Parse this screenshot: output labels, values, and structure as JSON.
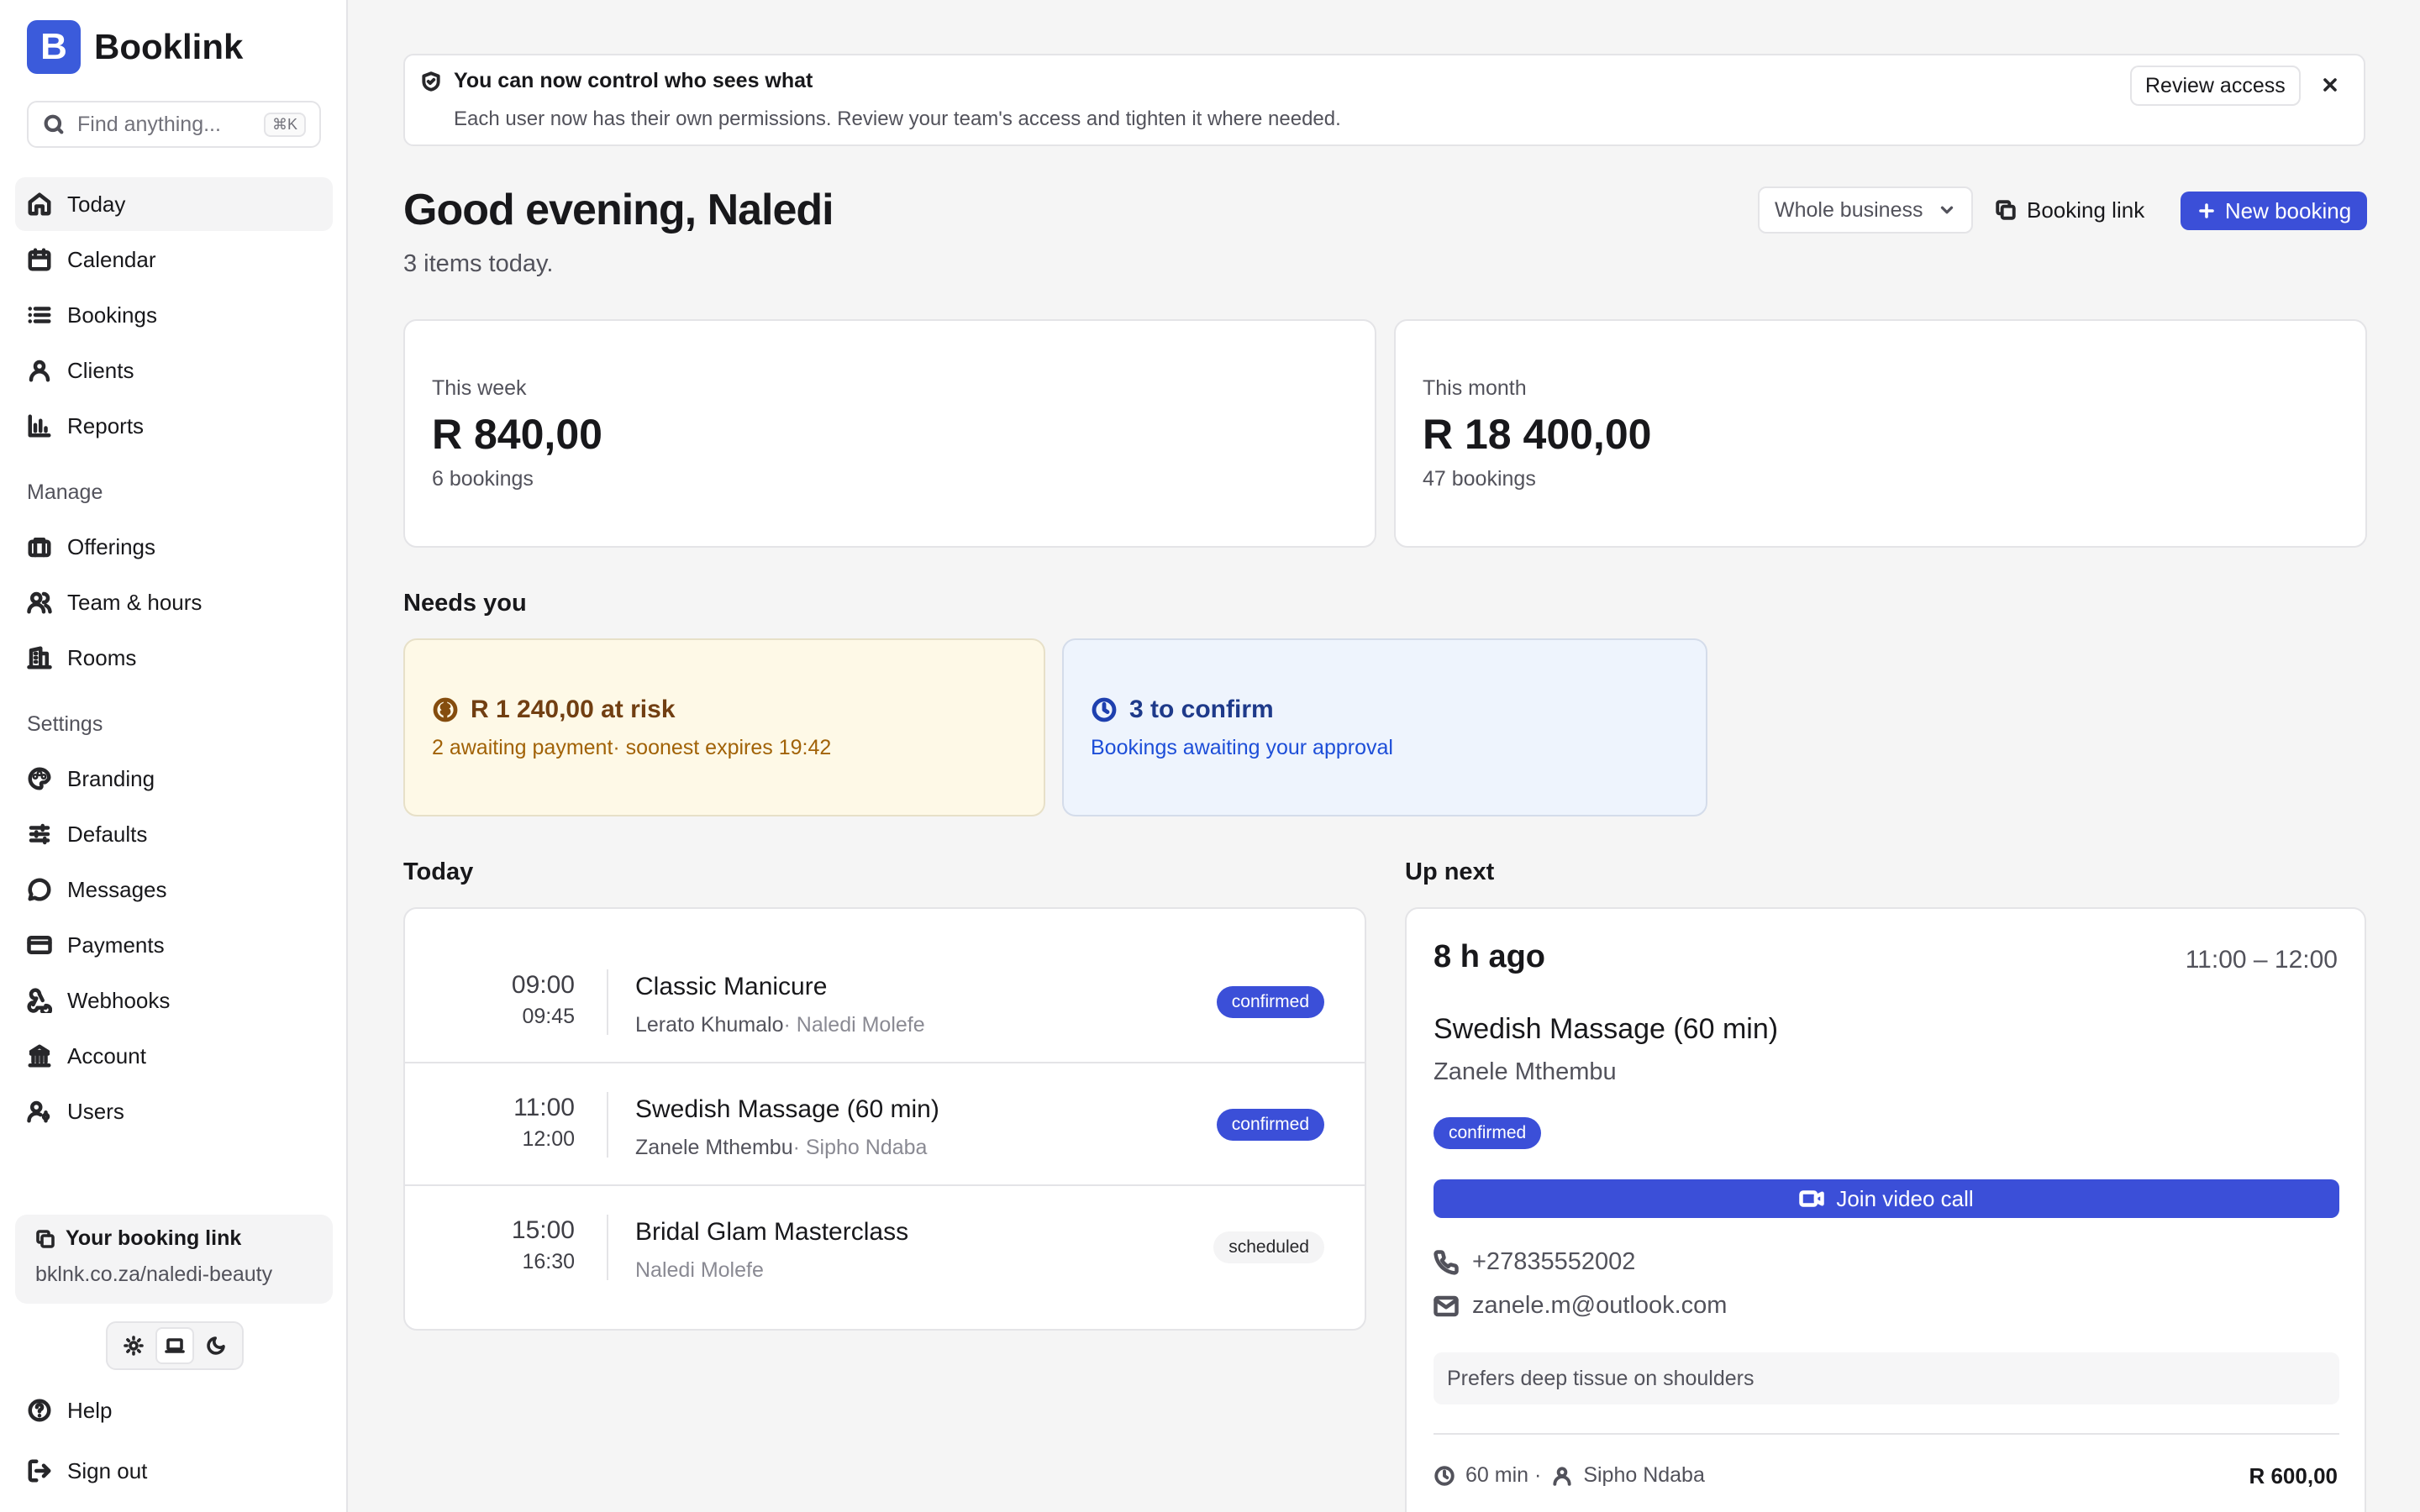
{
  "app": {
    "name": "Booklink",
    "logo_letter": "B"
  },
  "search": {
    "placeholder": "Find anything...",
    "shortcut": "⌘K"
  },
  "nav": {
    "main": [
      {
        "label": "Today",
        "icon": "home-icon",
        "active": true
      },
      {
        "label": "Calendar",
        "icon": "calendar-icon"
      },
      {
        "label": "Bookings",
        "icon": "list-icon"
      },
      {
        "label": "Clients",
        "icon": "users-icon"
      },
      {
        "label": "Reports",
        "icon": "bar-chart-icon"
      }
    ],
    "manage_label": "Manage",
    "manage": [
      {
        "label": "Offerings",
        "icon": "briefcase-icon"
      },
      {
        "label": "Team & hours",
        "icon": "team-icon"
      },
      {
        "label": "Rooms",
        "icon": "building-icon"
      }
    ],
    "settings_label": "Settings",
    "settings": [
      {
        "label": "Branding",
        "icon": "palette-icon"
      },
      {
        "label": "Defaults",
        "icon": "sliders-icon"
      },
      {
        "label": "Messages",
        "icon": "message-icon"
      },
      {
        "label": "Payments",
        "icon": "credit-card-icon"
      },
      {
        "label": "Webhooks",
        "icon": "webhook-icon"
      },
      {
        "label": "Account",
        "icon": "bank-icon"
      },
      {
        "label": "Users",
        "icon": "user-key-icon"
      }
    ],
    "help": "Help",
    "signout": "Sign out"
  },
  "booking_link": {
    "title": "Your booking link",
    "url": "bklnk.co.za/naledi-beauty"
  },
  "theme": {
    "options": [
      "light",
      "system",
      "dark"
    ],
    "selected": "system"
  },
  "banner": {
    "title": "You can now control who sees what",
    "text": "Each user now has their own permissions. Review your team's access and tighten it where needed.",
    "action": "Review access"
  },
  "header": {
    "greeting": "Good evening, Naledi",
    "subtitle": "3 items today.",
    "scope": "Whole business",
    "booking_link_btn": "Booking link",
    "new_booking_btn": "New booking"
  },
  "stats": [
    {
      "label": "This week",
      "value": "R 840,00",
      "count": "6 bookings"
    },
    {
      "label": "This month",
      "value": "R 18 400,00",
      "count": "47 bookings"
    }
  ],
  "needs_you": {
    "title": "Needs you",
    "alerts": [
      {
        "title": "R 1 240,00 at risk",
        "text": "2 awaiting payment· soonest expires 19:42",
        "color": "#fef9e7"
      },
      {
        "title": "3 to confirm",
        "text": "Bookings awaiting your approval",
        "color": "#eef4fd"
      }
    ]
  },
  "today": {
    "title": "Today",
    "items": [
      {
        "start": "09:00",
        "end": "09:45",
        "service": "Classic Manicure",
        "client": "Lerato Khumalo",
        "staff": "· Naledi Molefe",
        "status": "confirmed"
      },
      {
        "start": "11:00",
        "end": "12:00",
        "service": "Swedish Massage (60 min)",
        "client": "Zanele Mthembu",
        "staff": "· Sipho Ndaba",
        "status": "confirmed"
      },
      {
        "start": "15:00",
        "end": "16:30",
        "service": "Bridal Glam Masterclass",
        "client": "",
        "staff": "Naledi Molefe",
        "status": "scheduled"
      }
    ]
  },
  "up_next": {
    "title": "Up next",
    "relative": "8 h ago",
    "range": "11:00 – 12:00",
    "service": "Swedish Massage (60 min)",
    "client": "Zanele Mthembu",
    "status": "confirmed",
    "join": "Join video call",
    "phone": "+27835552002",
    "email": "zanele.m@outlook.com",
    "note": "Prefers deep tissue on shoulders",
    "duration": "60 min ·",
    "staff": "Sipho Ndaba",
    "price": "R 600,00"
  },
  "colors": {
    "accent": "#3b4fd8",
    "brand": "#3b5bdb"
  }
}
